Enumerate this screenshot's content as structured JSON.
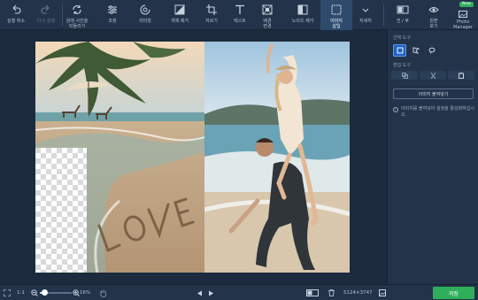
{
  "toolbar": {
    "undo": "실행 취소",
    "redo": "다시 실행",
    "revert": "원래 사진을\n되돌리기",
    "adjust": "조정",
    "retouch": "리터칭",
    "remove_object": "개체 제거",
    "crop": "자르기",
    "text": "텍스트",
    "change_bg": "배경\n변경",
    "remove_noise": "노이즈 제거",
    "image_insert": "이미지\n삽입",
    "more": "자세히",
    "before_after": "전 / 후",
    "view_original": "원본\n보기",
    "photo_manager": "Photo\nManager",
    "new_badge": "New"
  },
  "panel": {
    "select_tools": "선택 도구",
    "edit_tools": "편집 도구",
    "paste_image": "이미지 붙여넣기",
    "hint": "이미지를 붙여넣어 설정을 활성화하십시오."
  },
  "bottom": {
    "fit_label": "1:1",
    "zoom": "16%",
    "dimensions": "5124×3747",
    "save": "저장"
  },
  "zoom_level": 0.16,
  "colors": {
    "accent": "#2fae5a",
    "selected": "#1d5fc4",
    "toolbar_bg": "#22334a",
    "workspace_bg": "#1c2b3d"
  },
  "icons": [
    "undo-icon",
    "redo-icon",
    "revert-icon",
    "adjust-icon",
    "retouch-icon",
    "remove-object-icon",
    "crop-icon",
    "text-icon",
    "change-bg-icon",
    "noise-icon",
    "image-insert-icon",
    "chevron-down-icon",
    "before-after-icon",
    "eye-icon",
    "photo-manager-icon"
  ]
}
